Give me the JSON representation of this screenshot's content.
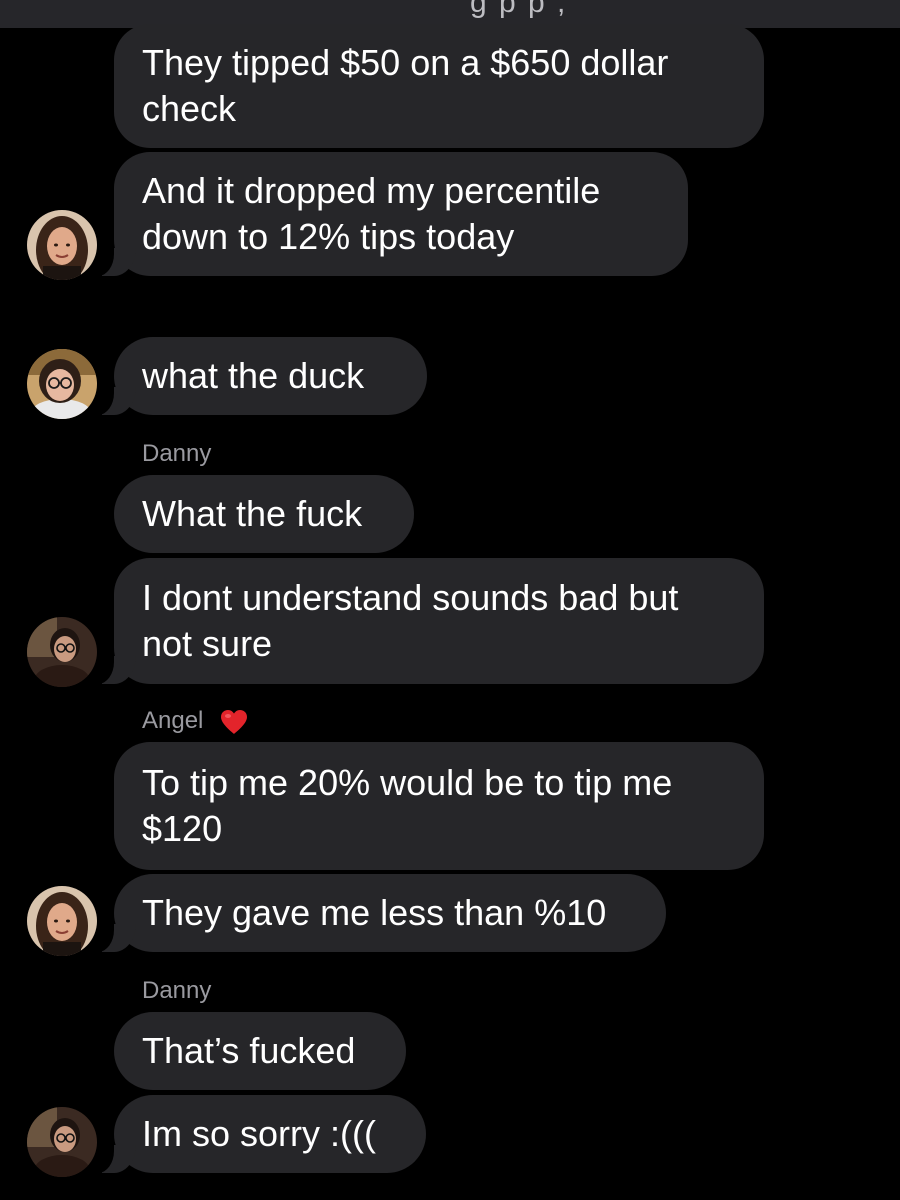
{
  "header": {
    "cut_text": "g   p   p ,"
  },
  "messages": [
    {
      "id": "m1",
      "text_lines": [
        "They tipped $50 on a $650 dollar",
        "check"
      ]
    },
    {
      "id": "m2",
      "text_lines": [
        "And it dropped my percentile",
        "down to 12% tips today"
      ]
    },
    {
      "id": "m3",
      "text_lines": [
        "what the duck"
      ]
    },
    {
      "id": "m4",
      "sender": "Danny",
      "text_lines": [
        "What the fuck"
      ]
    },
    {
      "id": "m5",
      "text_lines": [
        "I dont understand sounds bad but",
        "not sure"
      ]
    },
    {
      "id": "m6",
      "sender": "Angel",
      "text_lines": [
        "To tip me 20% would be to tip me",
        "$120"
      ]
    },
    {
      "id": "m7",
      "text_lines": [
        "They gave me less than %10"
      ]
    },
    {
      "id": "m8",
      "sender": "Danny",
      "text_lines": [
        "That’s fucked"
      ]
    },
    {
      "id": "m9",
      "text_lines": [
        "Im so sorry :((("
      ]
    }
  ],
  "colors": {
    "background": "#000000",
    "bubble": "#262629",
    "text": "#ffffff",
    "sender": "#9a9aa0",
    "heart": "#e3242b"
  },
  "icons": {
    "heart": "red-heart-icon"
  }
}
